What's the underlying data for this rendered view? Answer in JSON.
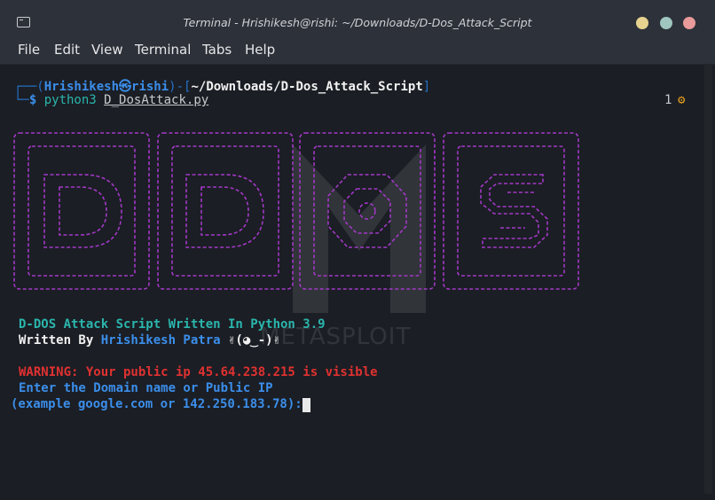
{
  "window": {
    "title": "Terminal - Hrishikesh@rishi: ~/Downloads/D-Dos_Attack_Script"
  },
  "menu": {
    "items": [
      "File",
      "Edit",
      "View",
      "Terminal",
      "Tabs",
      "Help"
    ]
  },
  "prompt": {
    "user": "Hrishikesh",
    "at_symbol": "㉿",
    "host": "rishi",
    "path": "~/Downloads/D-Dos_Attack_Script",
    "command": "python3",
    "argument": "D_DosAttack.py",
    "job_count": "1",
    "job_icon": "⚙"
  },
  "banner": {
    "letters": [
      "D",
      "D",
      "O",
      "S"
    ],
    "color": "#a238c7"
  },
  "watermark": {
    "text": "METASPLOIT"
  },
  "output": {
    "line1": "D-DOS Attack Script Written In Python 3.9",
    "line2_prefix": "Written By ",
    "line2_author": "Hrishikesh Patra",
    "line2_emoji": " ✌(◕‿-)✌",
    "warning": "WARNING: Your public ip 45.64.238.215 is visible",
    "prompt1": "Enter the Domain name or Public IP",
    "prompt2": "(example google.com or 142.250.183.78):- "
  }
}
